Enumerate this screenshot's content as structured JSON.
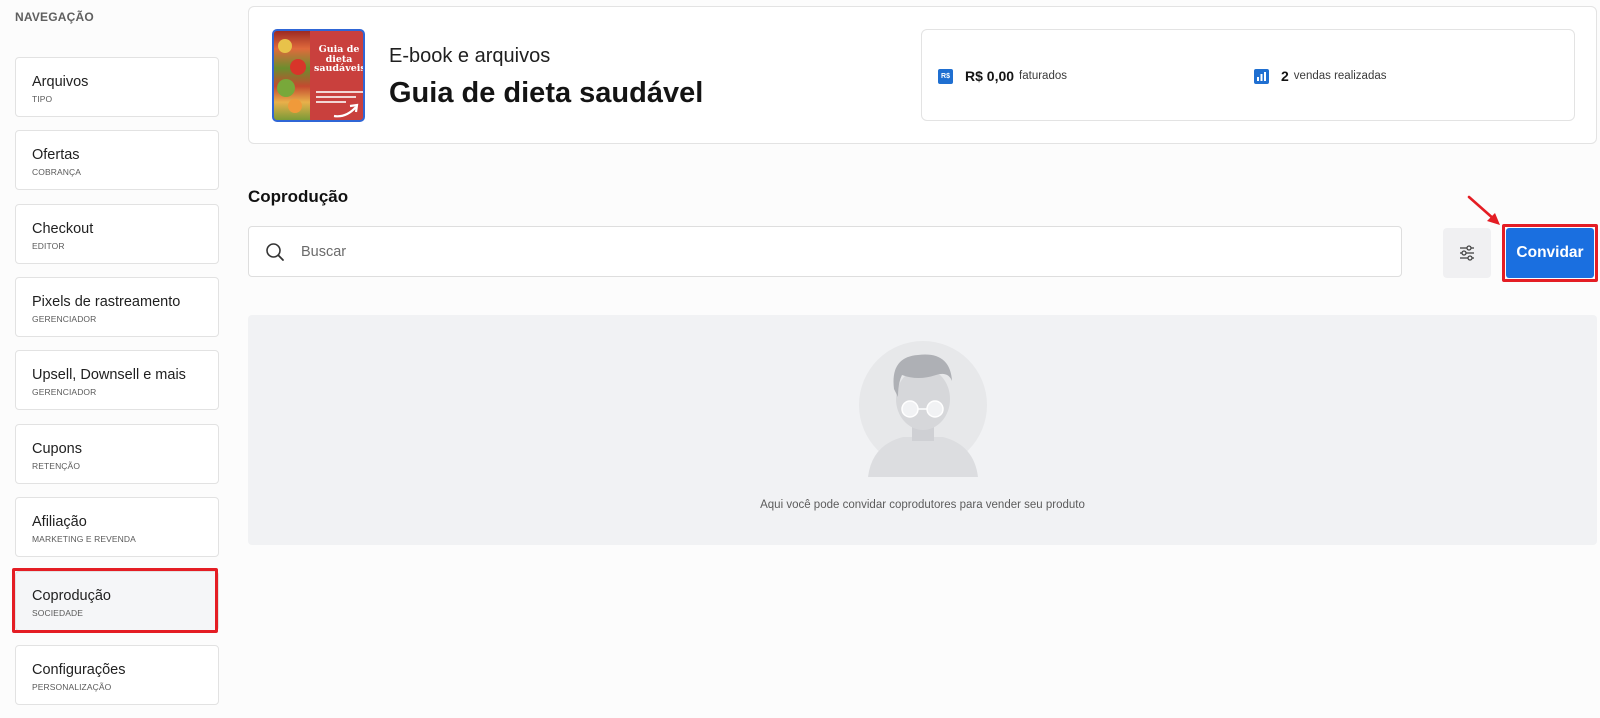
{
  "sidebar": {
    "heading": "NAVEGAÇÃO",
    "items": [
      {
        "title": "Arquivos",
        "subtitle": "TIPO"
      },
      {
        "title": "Ofertas",
        "subtitle": "COBRANÇA"
      },
      {
        "title": "Checkout",
        "subtitle": "EDITOR"
      },
      {
        "title": "Pixels de rastreamento",
        "subtitle": "GERENCIADOR"
      },
      {
        "title": "Upsell, Downsell e mais",
        "subtitle": "GERENCIADOR"
      },
      {
        "title": "Cupons",
        "subtitle": "RETENÇÃO"
      },
      {
        "title": "Afiliação",
        "subtitle": "MARKETING E REVENDA"
      },
      {
        "title": "Coprodução",
        "subtitle": "SOCIEDADE"
      },
      {
        "title": "Configurações",
        "subtitle": "PERSONALIZAÇÃO"
      }
    ],
    "active_item": "Coprodução"
  },
  "product": {
    "cover_title": "Guia de dieta saudáveis",
    "type": "E-book e arquivos",
    "name": "Guia de dieta saudável"
  },
  "stats": {
    "revenue_icon": "R$",
    "revenue_value": "R$ 0,00",
    "revenue_label": "faturados",
    "sales_value": "2",
    "sales_label": "vendas realizadas"
  },
  "section": {
    "title": "Coprodução",
    "search_placeholder": "Buscar",
    "invite_label": "Convidar",
    "empty_message": "Aqui você pode convidar coprodutores para vender seu produto"
  },
  "icons": {
    "search": "search-icon",
    "filter": "sliders-icon",
    "sales": "bar-chart-icon",
    "revenue": "currency-icon",
    "annotation": "red-arrow-icon"
  },
  "colors": {
    "accent": "#1a6fe0",
    "annotation": "#e41d24",
    "empty_bg": "#f1f2f4"
  }
}
